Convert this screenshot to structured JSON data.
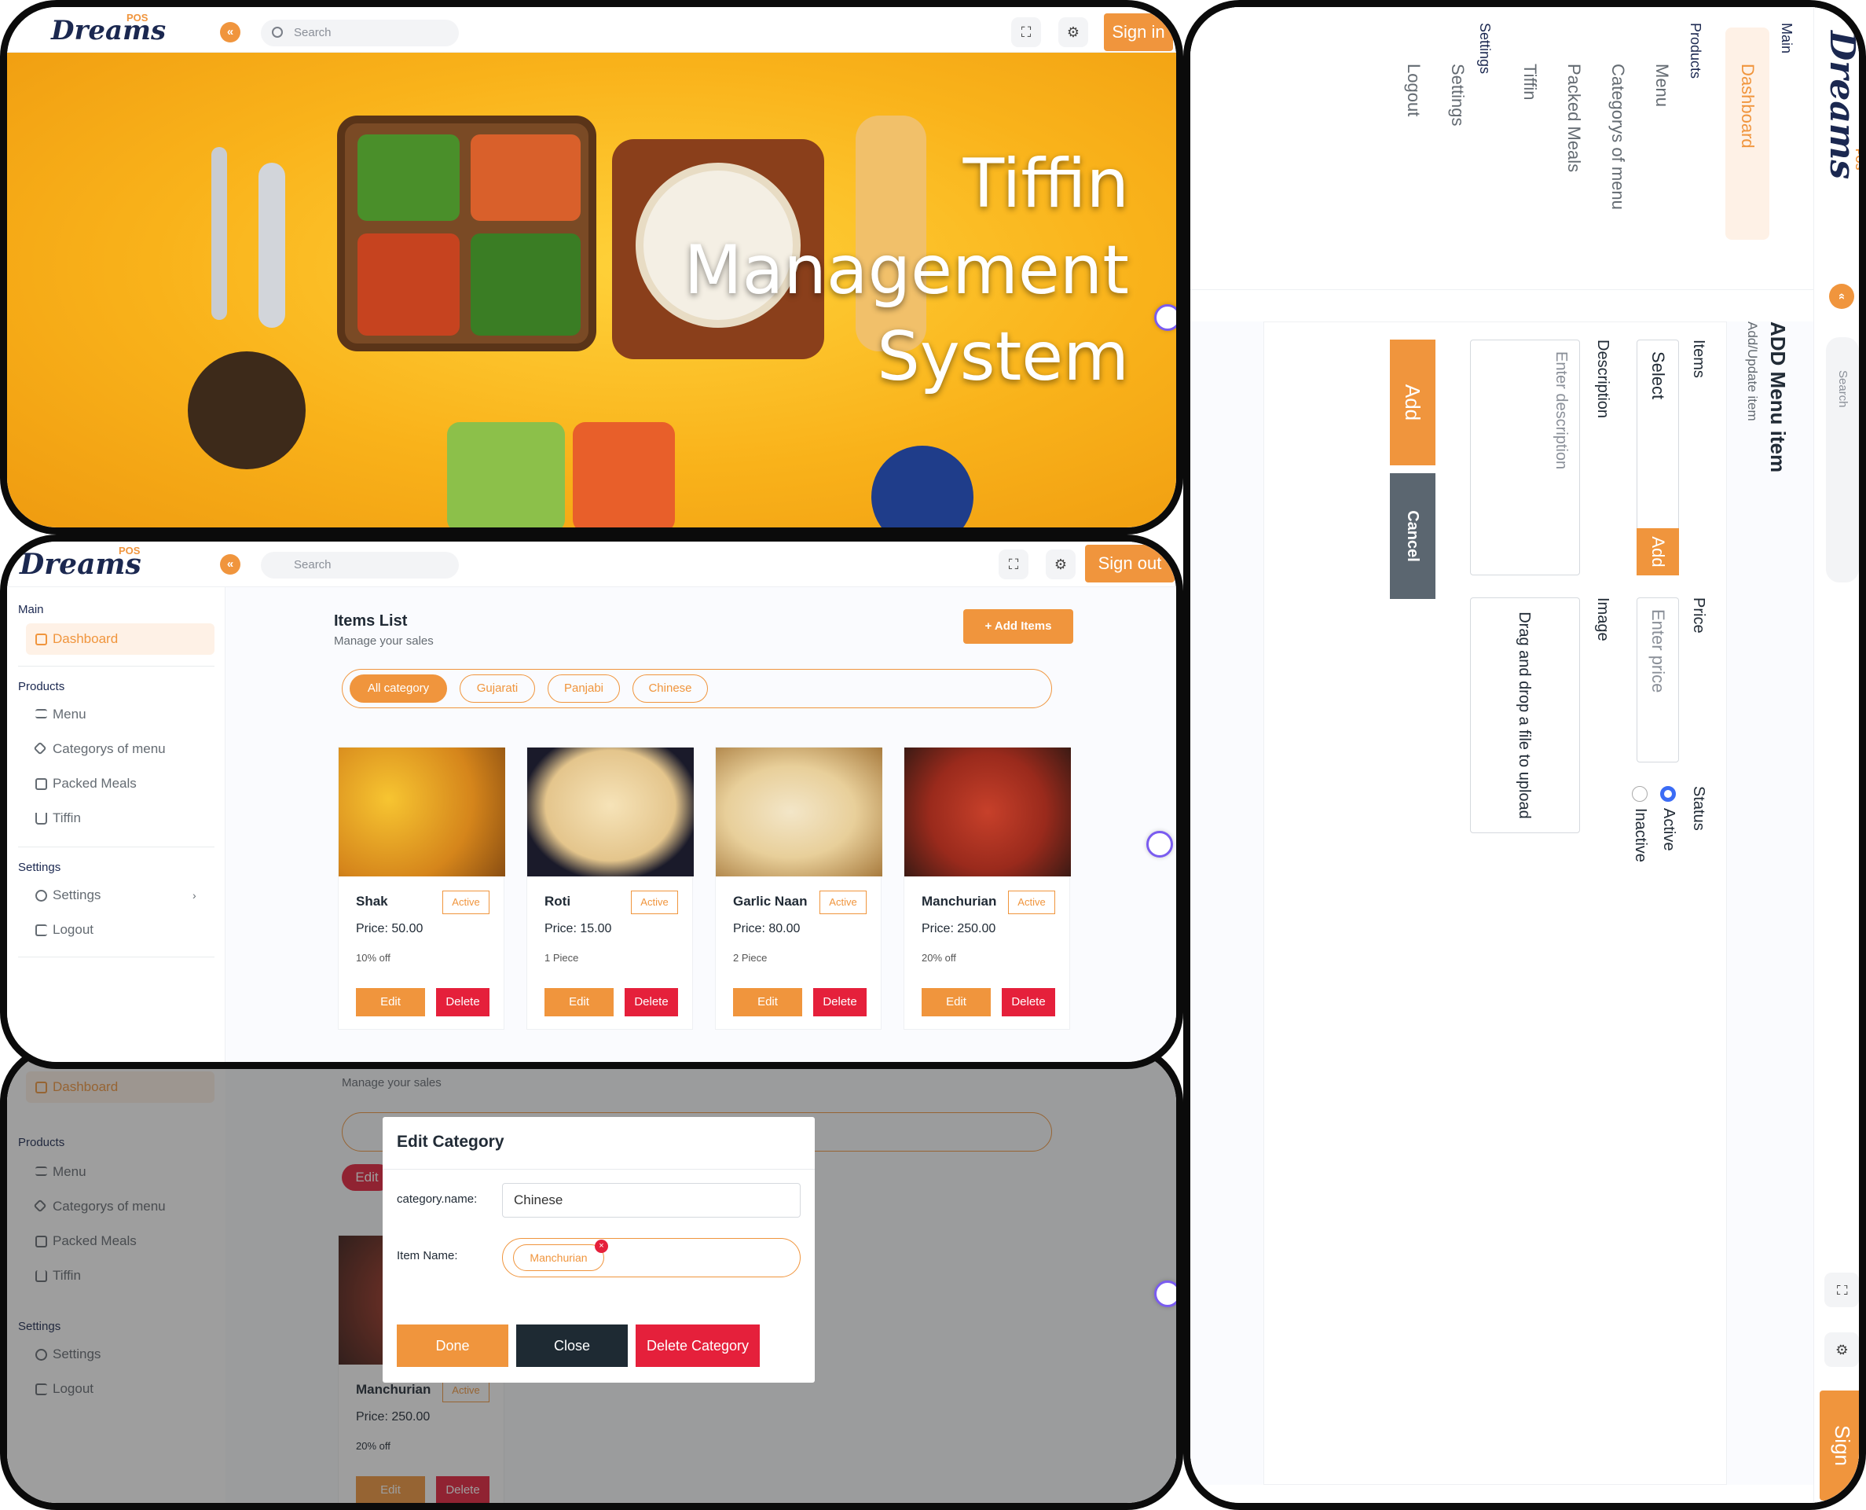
{
  "brand": {
    "logo_text": "Dreams",
    "logo_sup": "POS"
  },
  "search": {
    "placeholder": "Search"
  },
  "hero": {
    "signin_label": "Sign in",
    "title_lines": [
      "Tiffin",
      "Management",
      "System"
    ]
  },
  "sidebar": {
    "main_heading": "Main",
    "dashboard": "Dashboard",
    "products_heading": "Products",
    "menu": "Menu",
    "categories": "Categorys of menu",
    "packed": "Packed Meals",
    "tiffin": "Tiffin",
    "settings_heading": "Settings",
    "settings": "Settings",
    "logout": "Logout"
  },
  "items_list": {
    "signout_label": "Sign out",
    "title": "Items List",
    "subtitle": "Manage your sales",
    "add_button": "Add Items",
    "filters": [
      "All category",
      "Gujarati",
      "Panjabi",
      "Chinese"
    ],
    "cards": [
      {
        "name": "Shak",
        "badge": "Active",
        "price": "Price: 50.00",
        "note": "10% off",
        "edit": "Edit",
        "delete": "Delete"
      },
      {
        "name": "Roti",
        "badge": "Active",
        "price": "Price: 15.00",
        "note": "1 Piece",
        "edit": "Edit",
        "delete": "Delete"
      },
      {
        "name": "Garlic Naan",
        "badge": "Active",
        "price": "Price: 80.00",
        "note": "2 Piece",
        "edit": "Edit",
        "delete": "Delete"
      },
      {
        "name": "Manchurian",
        "badge": "Active",
        "price": "Price: 250.00",
        "note": "20% off",
        "edit": "Edit",
        "delete": "Delete"
      }
    ]
  },
  "edit_modal": {
    "title": "Edit Category",
    "name_label": "category.name:",
    "name_value": "Chinese",
    "item_label": "Item Name:",
    "item_tag": "Manchurian",
    "done": "Done",
    "close": "Close",
    "delete": "Delete Category",
    "bg_subtitle": "Manage your sales",
    "bg_edit": "Edit",
    "bg_card_name": "Manchurian",
    "bg_card_badge": "Active",
    "bg_card_price": "Price: 250.00",
    "bg_card_note": "20% off",
    "bg_card_edit": "Edit",
    "bg_card_delete": "Delete"
  },
  "add_menu": {
    "title": "ADD Menu item",
    "subtitle": "Add/Update item",
    "items_label": "Items",
    "items_select": "Select",
    "items_add": "Add",
    "price_label": "Price",
    "price_placeholder": "Enter price",
    "status_label": "Status",
    "active": "Active",
    "inactive": "Inactive",
    "desc_label": "Description",
    "desc_placeholder": "Enter description",
    "image_label": "Image",
    "upload_text": "Drag and drop a file to upload",
    "add_btn": "Add",
    "cancel_btn": "Cancel",
    "signin_partial": "Sign"
  },
  "colors": {
    "accent": "#f0953d",
    "danger": "#e5203b",
    "dark": "#1b2850",
    "slate": "#5b6670"
  }
}
